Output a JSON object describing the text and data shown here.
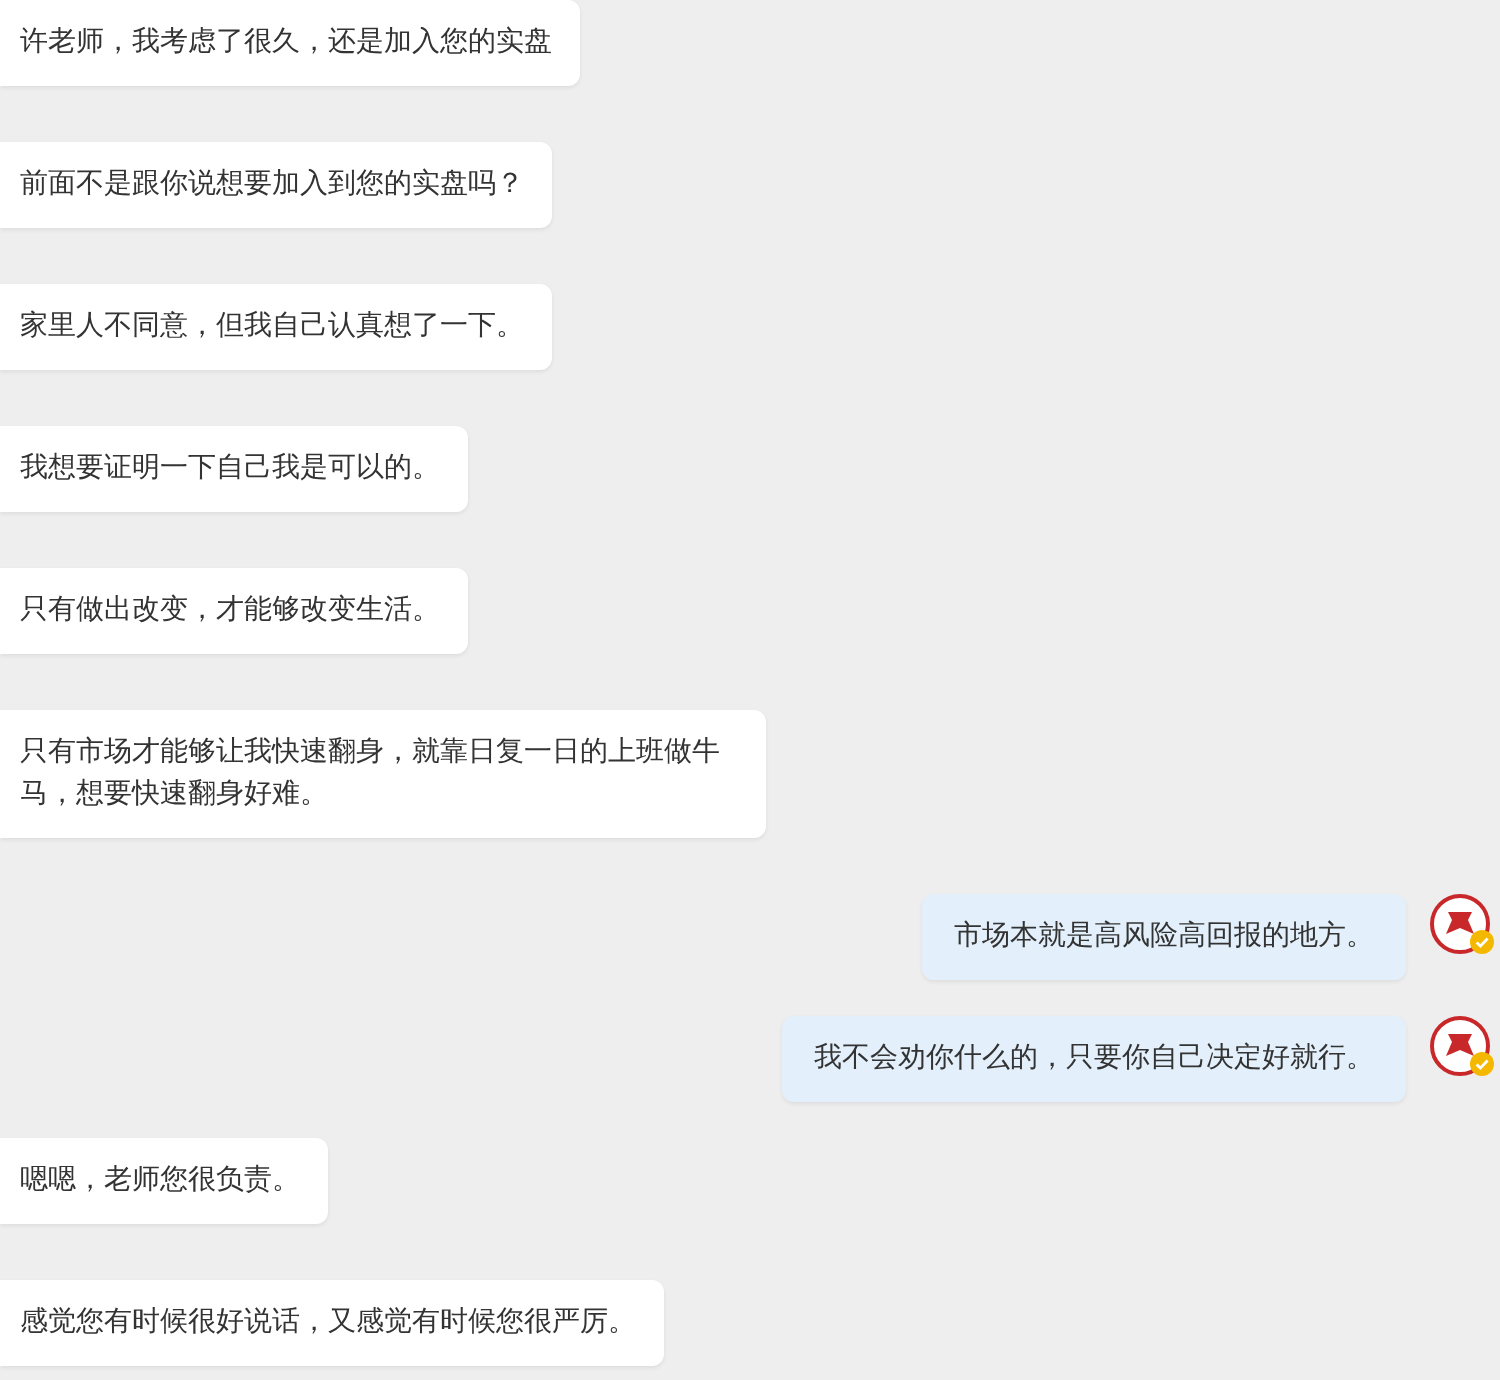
{
  "messages": [
    {
      "kind": "incoming",
      "text": "许老师，我考虑了很久，还是加入您的实盘"
    },
    {
      "kind": "incoming",
      "text": "前面不是跟你说想要加入到您的实盘吗？"
    },
    {
      "kind": "incoming",
      "text": "家里人不同意，但我自己认真想了一下。"
    },
    {
      "kind": "incoming",
      "text": "我想要证明一下自己我是可以的。"
    },
    {
      "kind": "incoming",
      "text": "只有做出改变，才能够改变生活。"
    },
    {
      "kind": "incoming",
      "text": "只有市场才能够让我快速翻身，就靠日复一日的上班做牛马，想要快速翻身好难。"
    },
    {
      "kind": "outgoing",
      "text": "市场本就是高风险高回报的地方。",
      "avatar": {
        "verified": true
      }
    },
    {
      "kind": "outgoing",
      "text": "我不会劝你什么的，只要你自己决定好就行。",
      "avatar": {
        "verified": true
      }
    },
    {
      "kind": "incoming",
      "text": "嗯嗯，老师您很负责。"
    },
    {
      "kind": "incoming",
      "text": "感觉您有时候很好说话，又感觉有时候您很严厉。"
    }
  ]
}
